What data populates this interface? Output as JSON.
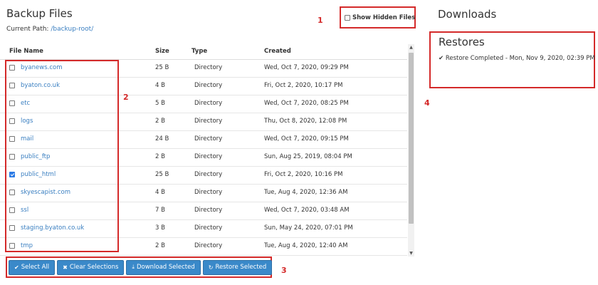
{
  "header": {
    "title": "Backup Files",
    "current_path_label": "Current Path:",
    "current_path_value": "/backup-root/"
  },
  "hidden_files": {
    "label": "Show Hidden Files",
    "checked": false
  },
  "table": {
    "columns": [
      "File Name",
      "Size",
      "Type",
      "Created"
    ],
    "rows": [
      {
        "name": "byanews.com",
        "size": "25 B",
        "type": "Directory",
        "created": "Wed, Oct 7, 2020, 09:29 PM",
        "checked": false
      },
      {
        "name": "byaton.co.uk",
        "size": "4 B",
        "type": "Directory",
        "created": "Fri, Oct 2, 2020, 10:17 PM",
        "checked": false
      },
      {
        "name": "etc",
        "size": "5 B",
        "type": "Directory",
        "created": "Wed, Oct 7, 2020, 08:25 PM",
        "checked": false
      },
      {
        "name": "logs",
        "size": "2 B",
        "type": "Directory",
        "created": "Thu, Oct 8, 2020, 12:08 PM",
        "checked": false
      },
      {
        "name": "mail",
        "size": "24 B",
        "type": "Directory",
        "created": "Wed, Oct 7, 2020, 09:15 PM",
        "checked": false
      },
      {
        "name": "public_ftp",
        "size": "2 B",
        "type": "Directory",
        "created": "Sun, Aug 25, 2019, 08:04 PM",
        "checked": false
      },
      {
        "name": "public_html",
        "size": "25 B",
        "type": "Directory",
        "created": "Fri, Oct 2, 2020, 10:16 PM",
        "checked": true
      },
      {
        "name": "skyescapist.com",
        "size": "4 B",
        "type": "Directory",
        "created": "Tue, Aug 4, 2020, 12:36 AM",
        "checked": false
      },
      {
        "name": "ssl",
        "size": "7 B",
        "type": "Directory",
        "created": "Wed, Oct 7, 2020, 03:48 AM",
        "checked": false
      },
      {
        "name": "staging.byaton.co.uk",
        "size": "3 B",
        "type": "Directory",
        "created": "Sun, May 24, 2020, 07:01 PM",
        "checked": false
      },
      {
        "name": "tmp",
        "size": "2 B",
        "type": "Directory",
        "created": "Tue, Aug 4, 2020, 12:40 AM",
        "checked": false
      }
    ]
  },
  "actions": {
    "select_all": "Select All",
    "clear_selections": "Clear Selections",
    "download_selected": "Download Selected",
    "restore_selected": "Restore Selected"
  },
  "sidebar": {
    "downloads_title": "Downloads",
    "restores_title": "Restores",
    "restore_status": "Restore Completed - Mon, Nov 9, 2020, 02:39 PM"
  },
  "markers": [
    "1",
    "2",
    "3",
    "4"
  ],
  "colors": {
    "accent": "#3a89c9",
    "link": "#3a7fc1",
    "annotation": "#d42a2a"
  },
  "icons": {
    "select_all": "check-icon",
    "clear_selections": "x-icon",
    "download_selected": "download-icon",
    "restore_selected": "refresh-icon",
    "restore_status": "check-icon"
  }
}
